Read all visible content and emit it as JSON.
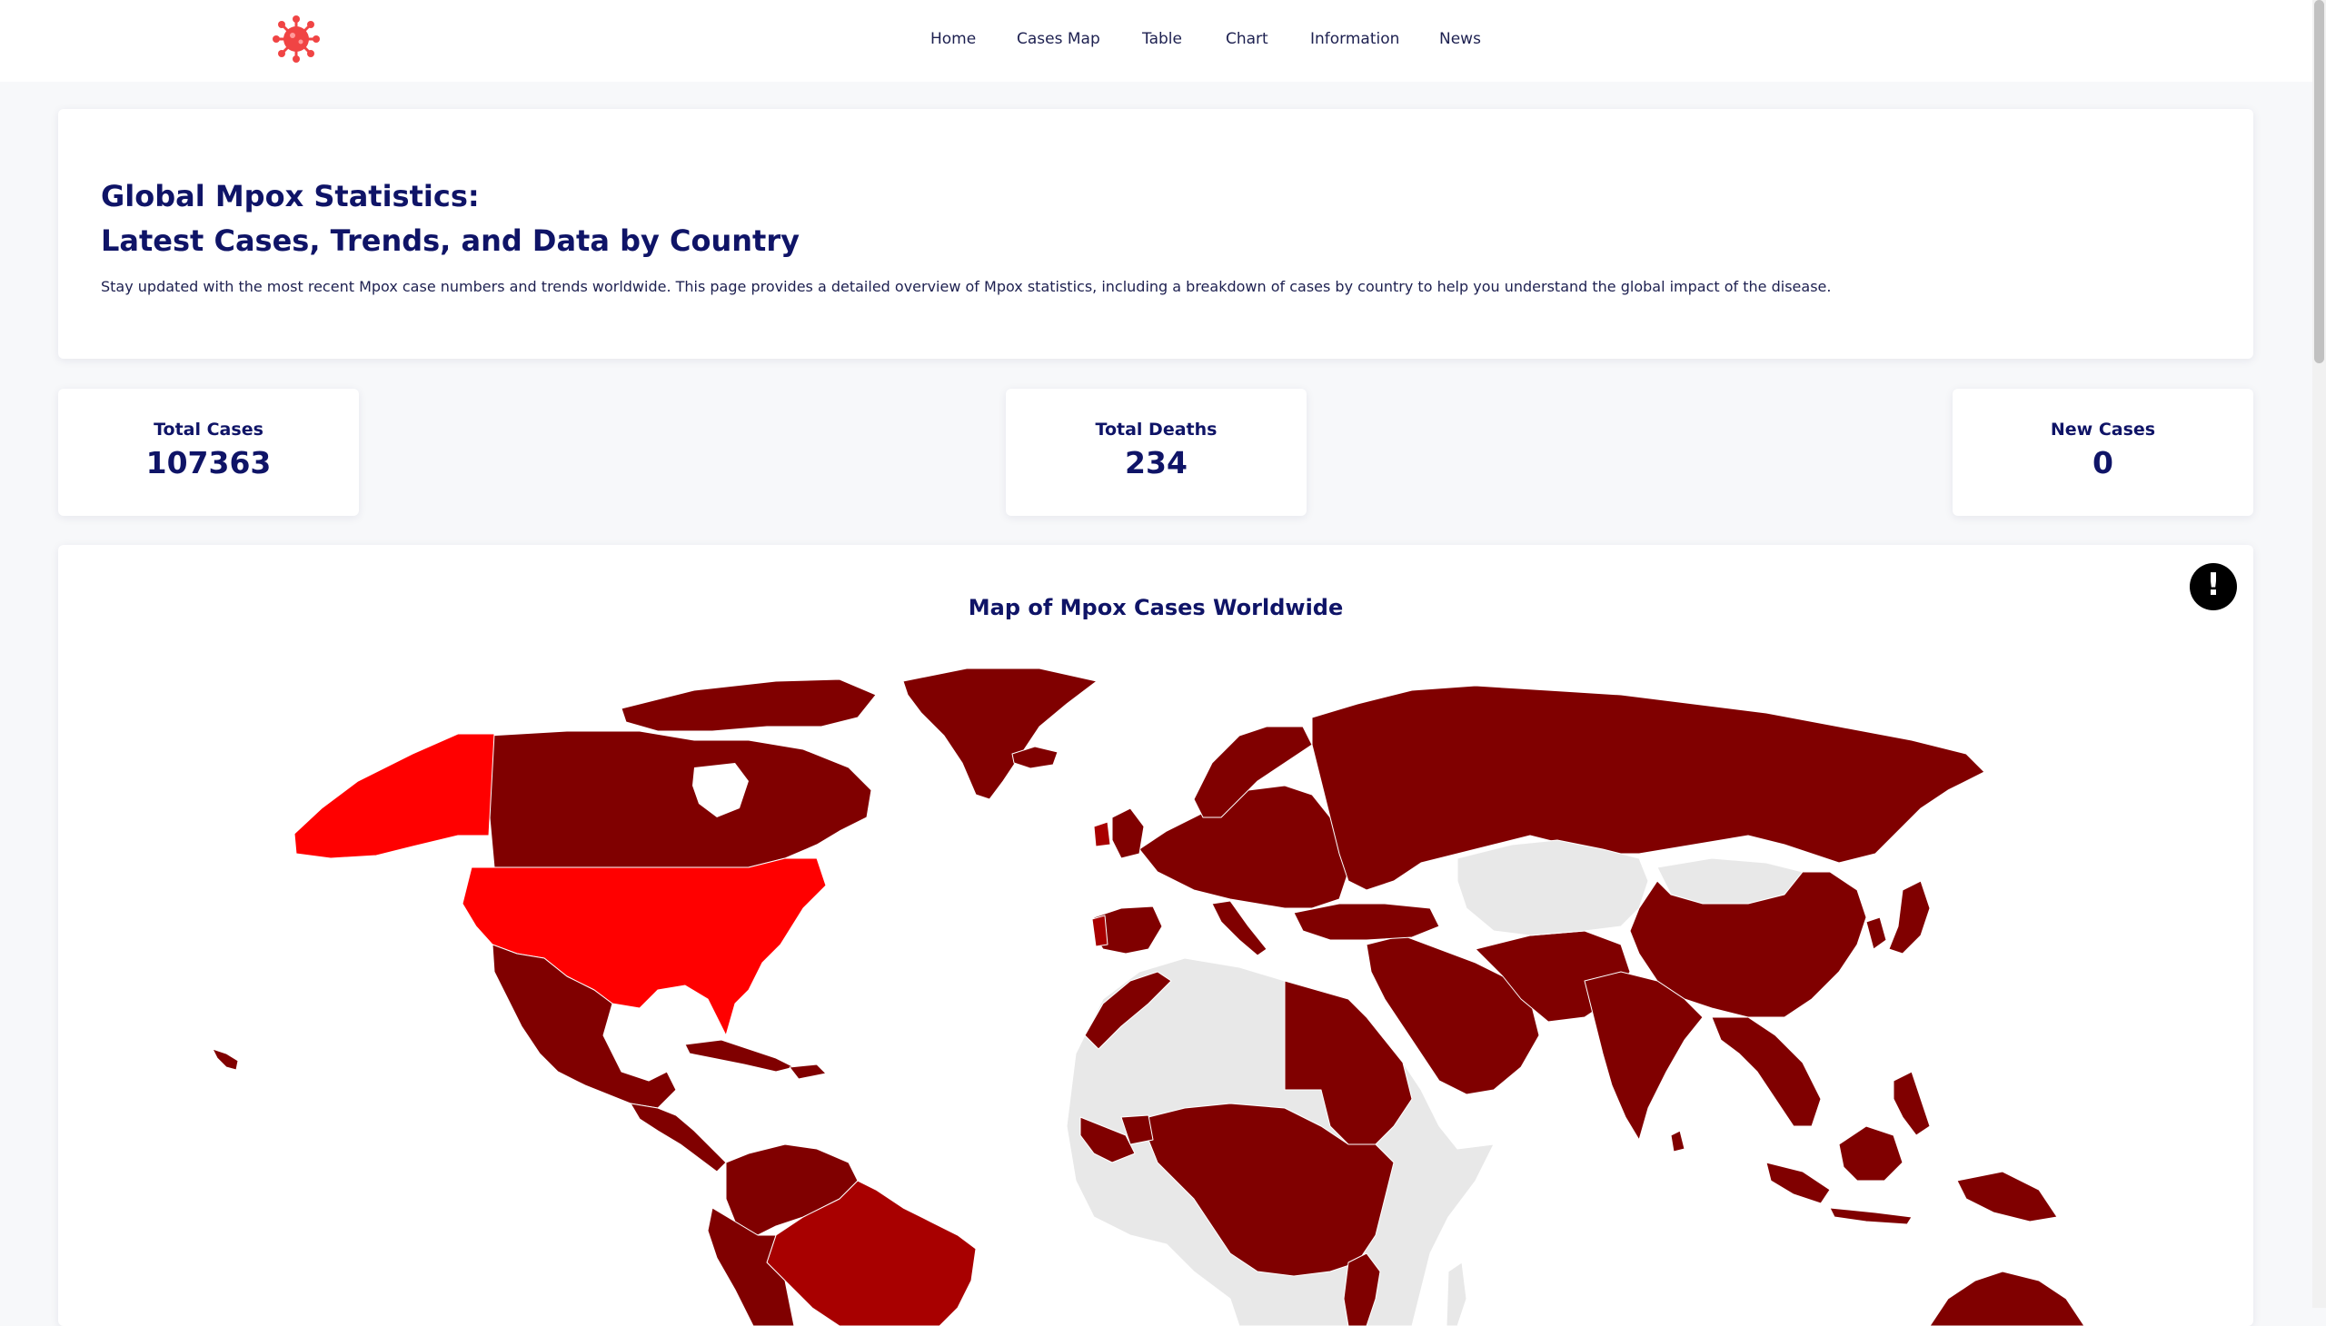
{
  "nav": {
    "logo_icon": "virus-icon",
    "links": [
      "Home",
      "Cases Map",
      "Table",
      "Chart",
      "Information",
      "News"
    ]
  },
  "intro": {
    "title_line1": "Global Mpox Statistics:",
    "title_line2": "Latest Cases, Trends, and Data by Country",
    "description": "Stay updated with the most recent Mpox case numbers and trends worldwide. This page provides a detailed overview of Mpox statistics, including a breakdown of cases by country to help you understand the global impact of the disease."
  },
  "stats": {
    "total_cases_label": "Total Cases",
    "total_cases_value": "107363",
    "total_deaths_label": "Total Deaths",
    "total_deaths_value": "234",
    "new_cases_label": "New Cases",
    "new_cases_value": "0"
  },
  "map": {
    "title": "Map of Mpox Cases Worldwide",
    "info_icon": "exclamation-icon",
    "colors": {
      "highest": "#ff0000",
      "high": "#a80000",
      "medium": "#800000",
      "none": "#e8e8e8"
    }
  }
}
